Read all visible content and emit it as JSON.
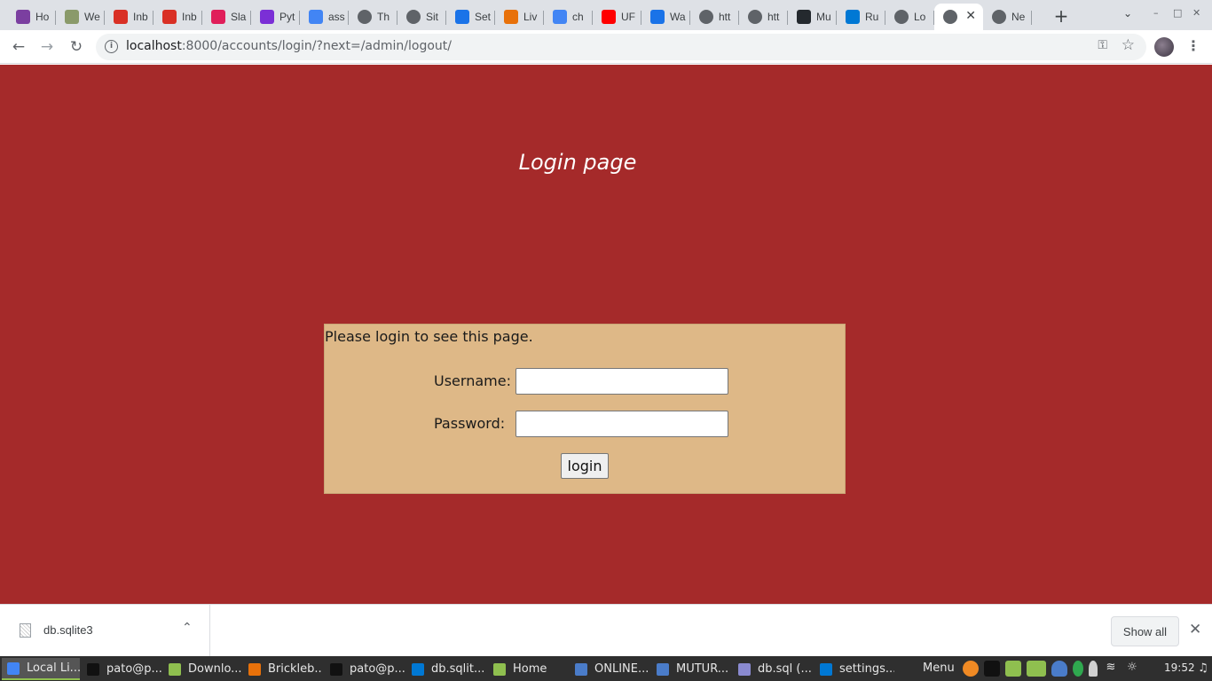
{
  "browser": {
    "tabs": [
      {
        "title": "Ho",
        "icon": "purple-square-icon",
        "color": "#7b3fa0"
      },
      {
        "title": "We",
        "icon": "tree-icon",
        "color": "#8a9a6a"
      },
      {
        "title": "Inb",
        "icon": "gmail-icon",
        "color": "#d93025"
      },
      {
        "title": "Inb",
        "icon": "gmail-icon",
        "color": "#d93025"
      },
      {
        "title": "Sla",
        "icon": "slack-icon",
        "color": "#e01e5a"
      },
      {
        "title": "Pyt",
        "icon": "pycharm-icon",
        "color": "#7b2fd6"
      },
      {
        "title": "ass",
        "icon": "google-icon",
        "color": "#4285f4"
      },
      {
        "title": "Th",
        "icon": "globe-icon",
        "color": "#5f6368"
      },
      {
        "title": "Sit",
        "icon": "globe-icon",
        "color": "#5f6368"
      },
      {
        "title": "Set",
        "icon": "gear-icon",
        "color": "#1a73e8"
      },
      {
        "title": "Liv",
        "icon": "ls-icon",
        "color": "#e8710a"
      },
      {
        "title": "ch",
        "icon": "google-icon",
        "color": "#4285f4"
      },
      {
        "title": "UF",
        "icon": "youtube-icon",
        "color": "#ff0000"
      },
      {
        "title": "Wa",
        "icon": "wa-icon",
        "color": "#1a73e8"
      },
      {
        "title": "htt",
        "icon": "globe-icon",
        "color": "#5f6368"
      },
      {
        "title": "htt",
        "icon": "globe-icon",
        "color": "#5f6368"
      },
      {
        "title": "Mu",
        "icon": "github-icon",
        "color": "#24292e"
      },
      {
        "title": "Ru",
        "icon": "vscode-icon",
        "color": "#0078d4"
      },
      {
        "title": "Lo",
        "icon": "globe-icon",
        "color": "#5f6368"
      },
      {
        "title": "",
        "icon": "globe-icon",
        "color": "#5f6368",
        "active": true
      },
      {
        "title": "Ne",
        "icon": "chrome-icon",
        "color": "#5f6368"
      }
    ],
    "new_tab_label": "+",
    "url_host": "localhost",
    "url_path": ":8000/accounts/login/?next=/admin/logout/"
  },
  "page": {
    "title": "Login page",
    "message": "Please login to see this page.",
    "username_label": "Username:",
    "password_label": "Password:",
    "username_value": "",
    "password_value": "",
    "login_label": "login",
    "background_color": "#a52a2a",
    "box_color": "#deb887"
  },
  "downloads": {
    "file_name": "db.sqlite3",
    "show_all_label": "Show all"
  },
  "taskbar": {
    "items": [
      {
        "label": "Local Li...",
        "icon": "chrome-icon",
        "color": "#4285f4",
        "active": true
      },
      {
        "label": "pato@p...",
        "icon": "terminal-icon",
        "color": "#111111"
      },
      {
        "label": "Downlo...",
        "icon": "folder-icon",
        "color": "#8fbf4f"
      },
      {
        "label": "Brickleb...",
        "icon": "media-player-icon",
        "color": "#e8710a"
      },
      {
        "label": "pato@p...",
        "icon": "terminal-icon",
        "color": "#111111"
      },
      {
        "label": "db.sqlit...",
        "icon": "vscode-icon",
        "color": "#0078d4"
      },
      {
        "label": "Home",
        "icon": "folder-icon",
        "color": "#8fbf4f"
      },
      {
        "label": "ONLINE...",
        "icon": "document-icon",
        "color": "#4a7cc9"
      },
      {
        "label": "MUTUR...",
        "icon": "document-icon",
        "color": "#4a7cc9"
      },
      {
        "label": "db.sql (...",
        "icon": "text-editor-icon",
        "color": "#8a8ad0"
      },
      {
        "label": "settings...",
        "icon": "vscode-icon",
        "color": "#0078d4"
      }
    ],
    "menu_label": "Menu",
    "clock": "19:52"
  }
}
